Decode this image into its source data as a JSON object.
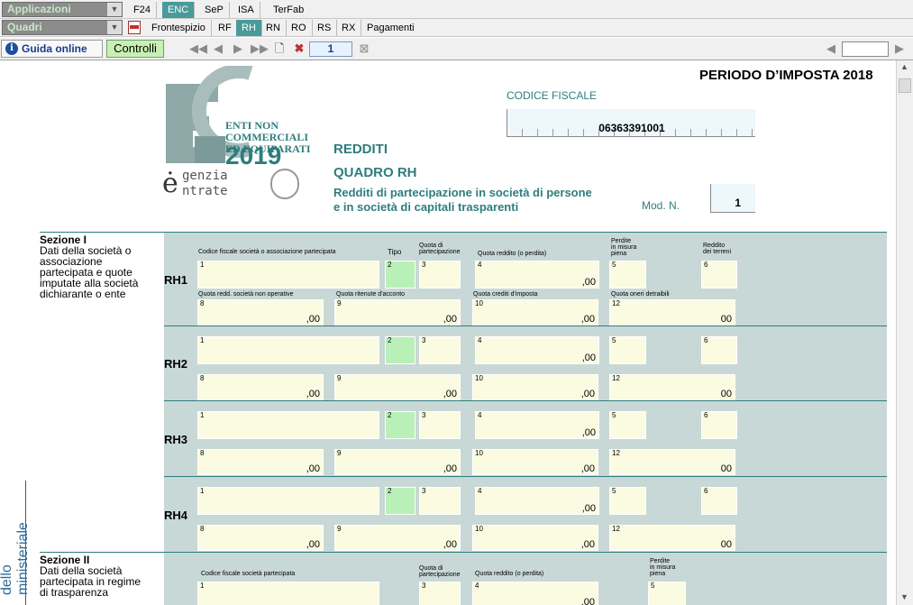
{
  "toolbar": {
    "applicazioni": "Applicazioni",
    "quadri": "Quadri",
    "top_tabs": [
      "F24",
      "ENC",
      "SeP",
      "ISA",
      "TerFab"
    ],
    "quadro_tabs": [
      "Frontespizio",
      "RF",
      "RH",
      "RN",
      "RO",
      "RS",
      "RX",
      "Pagamenti"
    ],
    "guida_label": "Guida online",
    "controlli_label": "Controlli",
    "page_number": "1"
  },
  "header": {
    "periodo": "PERIODO D’IMPOSTA 2018",
    "codice_fiscale_label": "CODICE FISCALE",
    "codice_fiscale": "06363391001",
    "logo_line1": "ENTI NON COMMERCIALI",
    "logo_line2": "ED EQUIPARATI",
    "logo_year": "2019",
    "agenzia_line1": "genzia",
    "agenzia_line2": "ntrate",
    "redditi": "REDDITI",
    "quadro": "QUADRO RH",
    "description_line1": "Redditi di partecipazione in società di persone",
    "description_line2": "e in società di capitali trasparenti",
    "mod_n_label": "Mod. N.",
    "mod_n": "1"
  },
  "sezione1": {
    "title": "Sezione I",
    "lines": [
      "Dati della società o",
      "associazione",
      "partecipata e quote",
      "imputate alla società",
      "dichiarante o ente"
    ],
    "headers": {
      "cf": "Codice fiscale società o associazione partecipata",
      "tipo": "Tipo",
      "quota_part_1": "Quota di",
      "quota_part_2": "partecipazione",
      "quota_reddito": "Quota reddito (o perdita)",
      "perdite_1": "Perdite",
      "perdite_2": "in misura",
      "perdite_3": "piena",
      "reddito_terreni_1": "Reddito",
      "reddito_terreni_2": "dei terreni",
      "quota_non_operative": "Quota redd. società non operative",
      "quota_ritenute": "Quota ritenute d'acconto",
      "quota_crediti": "Quota crediti d'imposta",
      "quota_oneri": "Quota oneri detraibili"
    },
    "rows": [
      "RH1",
      "RH2",
      "RH3",
      "RH4"
    ],
    "decimal": ",00",
    "decimal_plain": "00"
  },
  "sezione2": {
    "title": "Sezione II",
    "lines": [
      "Dati della società",
      "partecipata in regime",
      "di trasparenza"
    ],
    "headers": {
      "cf": "Codice fiscale società partecipata",
      "quota_part_1": "Quota di",
      "quota_part_2": "partecipazione",
      "quota_reddito": "Quota reddito (o perdita)",
      "perdite_1": "Perdite",
      "perdite_2": "in misura",
      "perdite_3": "piena"
    }
  },
  "side_text": "dello ministeriale"
}
